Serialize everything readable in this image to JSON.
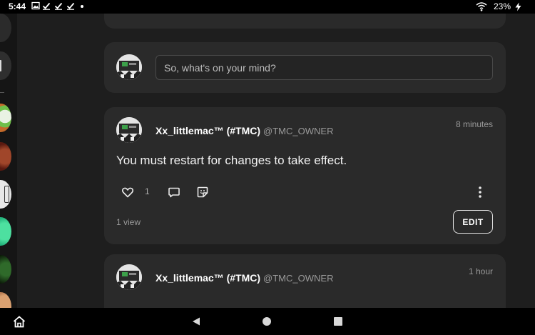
{
  "status_bar": {
    "time": "5:44",
    "battery": "23%",
    "icons": [
      "image-icon",
      "check-icon",
      "check-icon",
      "check-icon",
      "dot-icon",
      "wifi-icon",
      "battery-charging-icon"
    ]
  },
  "composer": {
    "placeholder": "So, what's on your mind?"
  },
  "posts": [
    {
      "author": "Xx_littlemac™ (#TMC)",
      "handle": "@TMC_OWNER",
      "time": "8 minutes",
      "text": "You must restart for changes to take effect.",
      "likes": "1",
      "views": "1 view",
      "edit_label": "EDIT"
    },
    {
      "author": "Xx_littlemac™ (#TMC)",
      "handle": "@TMC_OWNER",
      "time": "1 hour"
    }
  ],
  "nav_bar": {
    "icons": [
      "home-icon",
      "back-icon",
      "home-circle-icon",
      "recents-icon"
    ]
  },
  "colors": {
    "background": "#1e1e1e",
    "card": "#2a2a2a",
    "muted_text": "#9a9a9a"
  }
}
